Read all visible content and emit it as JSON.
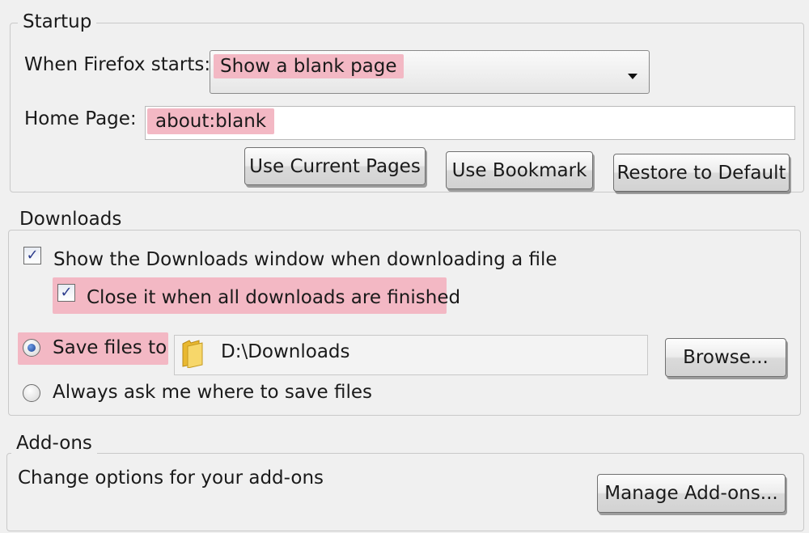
{
  "colors": {
    "highlight": "#f3b8c4",
    "window_bg": "#f0f0f0",
    "check_color": "#2b3b8c"
  },
  "startup": {
    "legend": "Startup",
    "when_label": "When Firefox starts:",
    "when_value": "Show a blank page",
    "home_label": "Home Page:",
    "home_value": "about:blank",
    "buttons": {
      "use_current": "Use Current Pages",
      "use_bookmark": "Use Bookmark",
      "restore_default": "Restore to Default"
    }
  },
  "downloads": {
    "legend": "Downloads",
    "show_window": {
      "label": "Show the Downloads window when downloading a file",
      "checked": true,
      "mark": "✓"
    },
    "close_it": {
      "label": "Close it when all downloads are finished",
      "checked": true,
      "mark": "✓"
    },
    "save_files": {
      "label": "Save files to",
      "selected": true
    },
    "path": "D:\\Downloads",
    "folder_icon": "folder-icon",
    "browse_button": "Browse...",
    "always_ask": {
      "label": "Always ask me where to save files",
      "selected": false
    }
  },
  "addons": {
    "legend": "Add-ons",
    "description": "Change options for your add-ons",
    "manage_button": "Manage Add-ons..."
  }
}
